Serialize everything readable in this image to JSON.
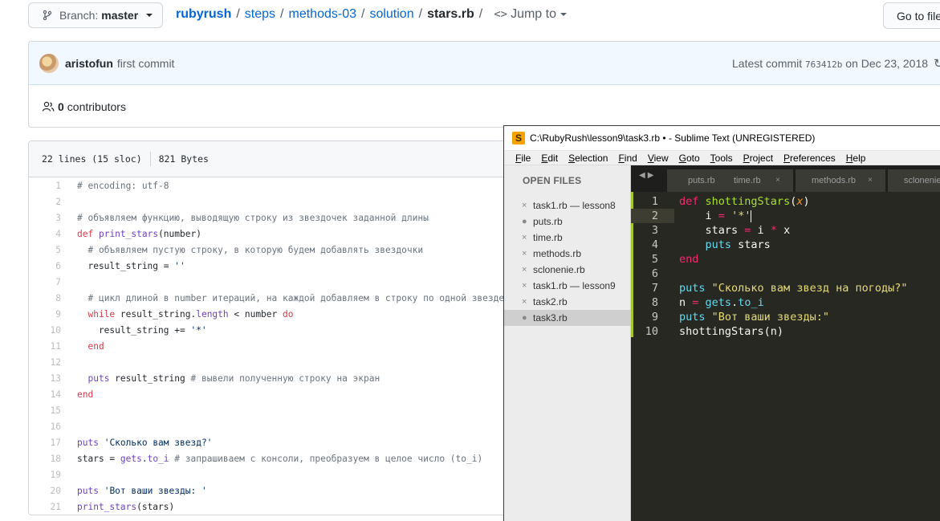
{
  "github": {
    "branch": {
      "label": "Branch:",
      "value": "master"
    },
    "breadcrumb": {
      "parts": [
        "rubyrush",
        "steps",
        "methods-03",
        "solution"
      ],
      "current": "stars.rb",
      "jump": "Jump to"
    },
    "goto_file": "Go to file",
    "commit": {
      "author": "aristofun",
      "message": "first commit",
      "latest_prefix": "Latest commit",
      "sha": "763412b",
      "date_text": "on Dec 23, 2018"
    },
    "contributors": {
      "count": "0",
      "label": "contributors"
    },
    "file_info": {
      "lines": "22 lines (15 sloc)",
      "size": "821 Bytes"
    },
    "code_lines": [
      {
        "n": "1",
        "t": "# encoding: utf-8"
      },
      {
        "n": "2",
        "t": ""
      },
      {
        "n": "3",
        "t": "# объявляем функцию, выводящую строку из звездочек заданной длины"
      },
      {
        "n": "4",
        "t": "def print_stars(number)"
      },
      {
        "n": "5",
        "t": "  # объявляем пустую строку, в которую будем добавлять звездочки"
      },
      {
        "n": "6",
        "t": "  result_string = ''"
      },
      {
        "n": "7",
        "t": ""
      },
      {
        "n": "8",
        "t": "  # цикл длиной в number итераций, на каждой добавляем в строку по одной звезде"
      },
      {
        "n": "9",
        "t": "  while result_string.length < number do"
      },
      {
        "n": "10",
        "t": "    result_string += '*'"
      },
      {
        "n": "11",
        "t": "  end"
      },
      {
        "n": "12",
        "t": ""
      },
      {
        "n": "13",
        "t": "  puts result_string # вывели полученную строку на экран"
      },
      {
        "n": "14",
        "t": "end"
      },
      {
        "n": "15",
        "t": ""
      },
      {
        "n": "16",
        "t": ""
      },
      {
        "n": "17",
        "t": "puts 'Сколько вам звезд?'"
      },
      {
        "n": "18",
        "t": "stars = gets.to_i # запрашиваем с консоли, преобразуем в целое число (to_i)"
      },
      {
        "n": "19",
        "t": ""
      },
      {
        "n": "20",
        "t": "puts 'Вот ваши звезды: '"
      },
      {
        "n": "21",
        "t": "print_stars(stars)"
      }
    ]
  },
  "sublime": {
    "title": "C:\\RubyRush\\lesson9\\task3.rb • - Sublime Text (UNREGISTERED)",
    "menu": [
      "File",
      "Edit",
      "Selection",
      "Find",
      "View",
      "Goto",
      "Tools",
      "Project",
      "Preferences",
      "Help"
    ],
    "sidebar_header": "OPEN FILES",
    "files": [
      {
        "mark": "×",
        "name": "task1.rb — lesson8"
      },
      {
        "mark": "●",
        "name": "puts.rb"
      },
      {
        "mark": "×",
        "name": "time.rb"
      },
      {
        "mark": "×",
        "name": "methods.rb"
      },
      {
        "mark": "×",
        "name": "sclonenie.rb"
      },
      {
        "mark": "×",
        "name": "task1.rb — lesson9"
      },
      {
        "mark": "×",
        "name": "task2.rb"
      },
      {
        "mark": "●",
        "name": "task3.rb"
      }
    ],
    "tabs": [
      {
        "name": "puts.rb",
        "mark": "●"
      },
      {
        "name": "time.rb",
        "mark": "×"
      },
      {
        "name": "methods.rb",
        "mark": "×"
      },
      {
        "name": "sclonenie",
        "mark": ""
      }
    ],
    "code_lines": [
      {
        "n": "1",
        "t": "def shottingStars(x)"
      },
      {
        "n": "2",
        "t": "    i = '*'"
      },
      {
        "n": "3",
        "t": "    stars = i * x"
      },
      {
        "n": "4",
        "t": "    puts stars"
      },
      {
        "n": "5",
        "t": "end"
      },
      {
        "n": "6",
        "t": ""
      },
      {
        "n": "7",
        "t": "puts \"Сколько вам звезд на погоды?\""
      },
      {
        "n": "8",
        "t": "n = gets.to_i"
      },
      {
        "n": "9",
        "t": "puts \"Вот ваши звезды:\""
      },
      {
        "n": "10",
        "t": "shottingStars(n)"
      }
    ]
  },
  "colors": {
    "link": "#0366d6",
    "monokai_bg": "#272822",
    "sublime_accent": "#f4a300"
  }
}
